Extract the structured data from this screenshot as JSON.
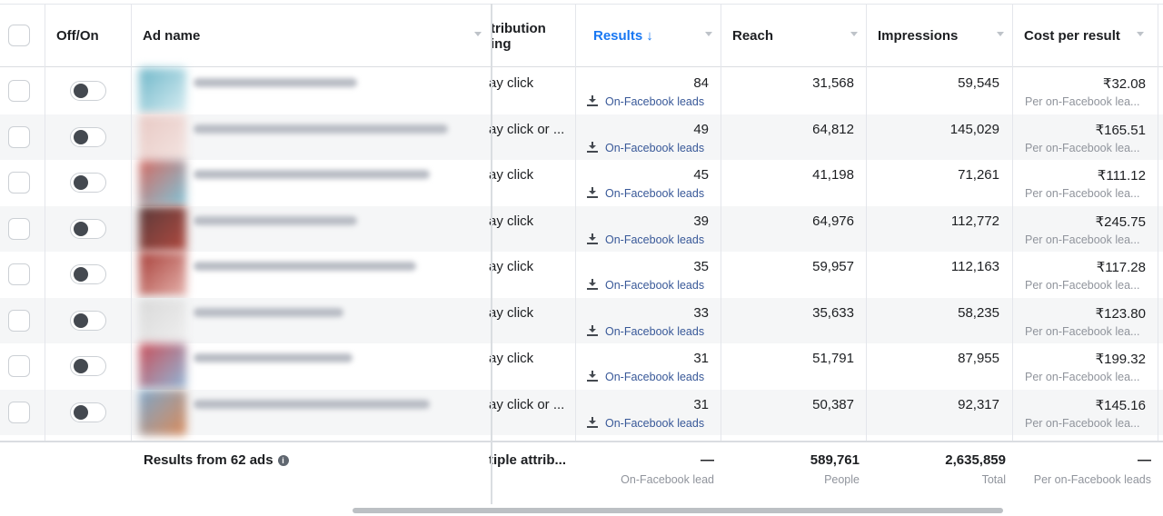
{
  "header": {
    "offon": "Off/On",
    "adname": "Ad name",
    "attribution_line1": "tribution",
    "attribution_line2": "ing",
    "results": "Results",
    "results_arrow": "↓",
    "reach": "Reach",
    "impressions": "Impressions",
    "cost": "Cost per result"
  },
  "colors": {
    "accent": "#1877f2",
    "lead_link": "#385898",
    "alt_row": "#f5f6f7"
  },
  "rows": [
    {
      "attribution": "ay click",
      "results": "84",
      "lead": "On-Facebook leads",
      "reach": "31,568",
      "impressions": "59,545",
      "cost": "₹32.08",
      "cost_sub": "Per on-Facebook lea..."
    },
    {
      "attribution": "ay click or ...",
      "results": "49",
      "lead": "On-Facebook leads",
      "reach": "64,812",
      "impressions": "145,029",
      "cost": "₹165.51",
      "cost_sub": "Per on-Facebook lea..."
    },
    {
      "attribution": "ay click",
      "results": "45",
      "lead": "On-Facebook leads",
      "reach": "41,198",
      "impressions": "71,261",
      "cost": "₹111.12",
      "cost_sub": "Per on-Facebook lea..."
    },
    {
      "attribution": "ay click",
      "results": "39",
      "lead": "On-Facebook leads",
      "reach": "64,976",
      "impressions": "112,772",
      "cost": "₹245.75",
      "cost_sub": "Per on-Facebook lea..."
    },
    {
      "attribution": "ay click",
      "results": "35",
      "lead": "On-Facebook leads",
      "reach": "59,957",
      "impressions": "112,163",
      "cost": "₹117.28",
      "cost_sub": "Per on-Facebook lea..."
    },
    {
      "attribution": "ay click",
      "results": "33",
      "lead": "On-Facebook leads",
      "reach": "35,633",
      "impressions": "58,235",
      "cost": "₹123.80",
      "cost_sub": "Per on-Facebook lea..."
    },
    {
      "attribution": "ay click",
      "results": "31",
      "lead": "On-Facebook leads",
      "reach": "51,791",
      "impressions": "87,955",
      "cost": "₹199.32",
      "cost_sub": "Per on-Facebook lea..."
    },
    {
      "attribution": "ay click or ...",
      "results": "31",
      "lead": "On-Facebook leads",
      "reach": "50,387",
      "impressions": "92,317",
      "cost": "₹145.16",
      "cost_sub": "Per on-Facebook lea..."
    }
  ],
  "footer": {
    "summary": "Results from 62 ads",
    "attribution": "tiple attrib...",
    "results": "—",
    "results_sub": "On-Facebook lead",
    "reach": "589,761",
    "reach_sub": "People",
    "impressions": "2,635,859",
    "impressions_sub": "Total",
    "cost": "—",
    "cost_sub": "Per on-Facebook leads"
  }
}
